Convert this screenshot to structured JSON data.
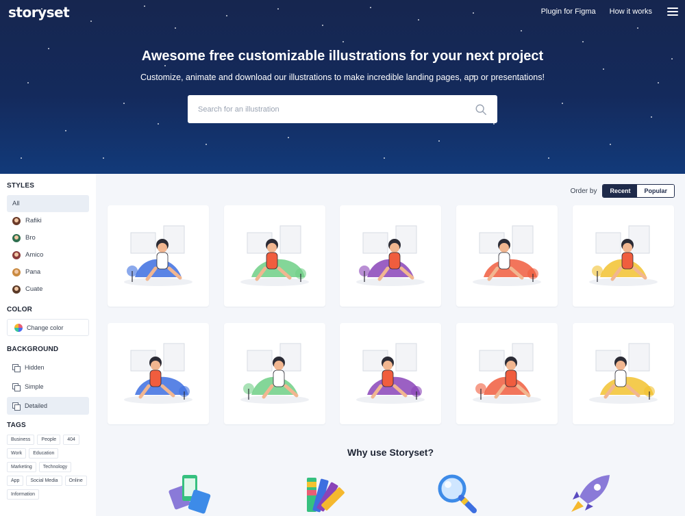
{
  "brand": {
    "logo_text": "storyset"
  },
  "nav": {
    "items": [
      "Plugin for Figma",
      "How it works"
    ],
    "menu_icon": "hamburger-icon"
  },
  "hero": {
    "title": "Awesome free customizable illustrations for your next project",
    "subtitle": "Customize, animate and download our illustrations to make incredible landing pages, app or presentations!",
    "search_placeholder": "Search for an illustration"
  },
  "sidebar": {
    "styles_heading": "STYLES",
    "styles": [
      {
        "label": "All",
        "active": true
      },
      {
        "label": "Rafiki",
        "avatar_color": "#6b3b2a"
      },
      {
        "label": "Bro",
        "avatar_color": "#2f6f4f"
      },
      {
        "label": "Amico",
        "avatar_color": "#8a3b3b"
      },
      {
        "label": "Pana",
        "avatar_color": "#c98a40"
      },
      {
        "label": "Cuate",
        "avatar_color": "#5a3a28"
      }
    ],
    "color_heading": "COLOR",
    "change_color_label": "Change color",
    "background_heading": "BACKGROUND",
    "backgrounds": [
      {
        "label": "Hidden"
      },
      {
        "label": "Simple"
      },
      {
        "label": "Detailed",
        "active": true
      }
    ],
    "tags_heading": "TAGS",
    "tags": [
      "Business",
      "People",
      "404",
      "Work",
      "Education",
      "Marketing",
      "Technology",
      "App",
      "Social Media",
      "Online",
      "Information"
    ]
  },
  "main": {
    "order_label": "Order by",
    "order_options": [
      {
        "label": "Recent",
        "active": true
      },
      {
        "label": "Popular"
      }
    ],
    "illustrations": [
      {
        "name": "woman-fan-room",
        "accent": "#3d6fe0"
      },
      {
        "name": "man-fan-armchair",
        "accent": "#6fcf86"
      },
      {
        "name": "woman-ice-cream-chair",
        "accent": "#8a44b8"
      },
      {
        "name": "man-fan-window",
        "accent": "#f05d3e"
      },
      {
        "name": "woman-yellow-fan",
        "accent": "#f2c230"
      },
      {
        "name": "woman-watermelon-umbrella",
        "accent": "#3d6fe0"
      },
      {
        "name": "woman-watermelon-slices",
        "accent": "#6fcf86"
      },
      {
        "name": "woman-watermelon-sitting",
        "accent": "#8a44b8"
      },
      {
        "name": "woman-eating-watermelon",
        "accent": "#f05d3e"
      },
      {
        "name": "man-laptop-watermelon",
        "accent": "#f2c230"
      }
    ],
    "why_heading": "Why use Storyset?",
    "features": [
      "phone-cards-icon",
      "color-palette-icon",
      "magnifier-icon",
      "rocket-icon"
    ]
  }
}
